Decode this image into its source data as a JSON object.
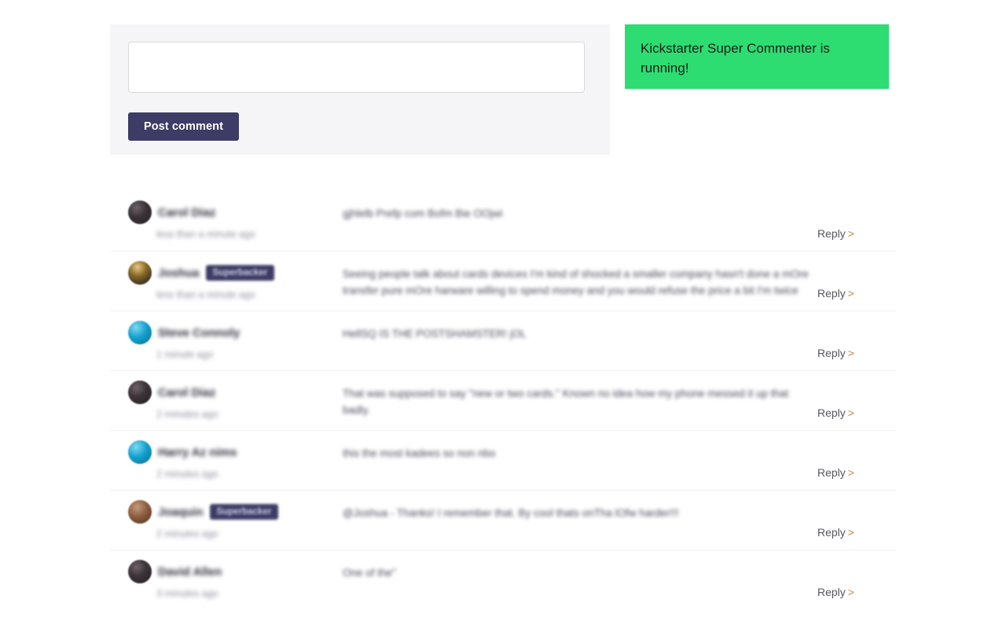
{
  "form": {
    "textarea_value": "",
    "textarea_placeholder": "",
    "post_button_label": "Post comment"
  },
  "status_banner": {
    "message": "Kickstarter Super Commenter is running!",
    "background_color": "#2ddd72",
    "text_color": "#1b1b1b"
  },
  "theme": {
    "button_color": "#3d3c66",
    "panel_background": "#f5f5f7",
    "badge_color": "#3d3c66",
    "chevron_color": "#d4823b"
  },
  "comments": {
    "reply_label": "Reply",
    "reply_chevron": ">",
    "items": [
      {
        "author": "Carol Diaz",
        "avatar_style": "dark",
        "badge": null,
        "timestamp": "less than a minute ago",
        "body": "gjhlelb Prefp com Bofm Bie OOjwi"
      },
      {
        "author": "Joshua",
        "avatar_style": "amber",
        "badge": "Superbacker",
        "timestamp": "less than a minute ago",
        "body": "Seeing people talk about cards devices I'm kind of shocked a smaller company hasn't done a mOre transfer pure mOre harware willing to spend money and you would refuse the price a bit I'm twice"
      },
      {
        "author": "Steve Connoly",
        "avatar_style": "blue",
        "badge": null,
        "timestamp": "1 minute ago",
        "body": "HellSQ IS THE POSTSHAMSTER! jOL"
      },
      {
        "author": "Carol Diaz",
        "avatar_style": "dark",
        "badge": null,
        "timestamp": "2 minutes ago",
        "body": "That was supposed to say \"new or two cards.\" Known no idea how my phone messed it up that badly."
      },
      {
        "author": "Harry Az nims",
        "avatar_style": "blue",
        "badge": null,
        "timestamp": "2 minutes ago",
        "body": "this the most kadees so non nbo"
      },
      {
        "author": "Joaquin",
        "avatar_style": "brown",
        "badge": "Superbacker",
        "timestamp": "2 minutes ago",
        "body": "@Joshua - Thanks! I remember that. By cool thats onTha lOfw harder!!!"
      },
      {
        "author": "David Allen",
        "avatar_style": "dark",
        "badge": null,
        "timestamp": "3 minutes ago",
        "body": "One of the\""
      }
    ]
  }
}
